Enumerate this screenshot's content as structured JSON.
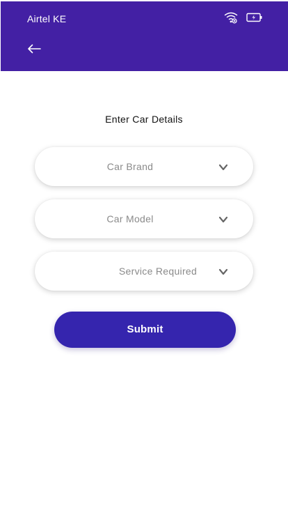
{
  "status_bar": {
    "carrier": "Airtel KE",
    "icons": [
      "wifi-icon",
      "battery-charging-icon"
    ]
  },
  "header": {
    "back_icon": "arrow-left-icon",
    "background_color": "#4320a4"
  },
  "form": {
    "title": "Enter Car Details",
    "fields": [
      {
        "label": "Car Brand",
        "icon": "chevron-down-icon"
      },
      {
        "label": "Car Model",
        "icon": "chevron-down-icon"
      },
      {
        "label": "Service Required",
        "icon": "chevron-down-icon"
      }
    ],
    "submit_label": "Submit",
    "submit_color": "#3525ae"
  }
}
